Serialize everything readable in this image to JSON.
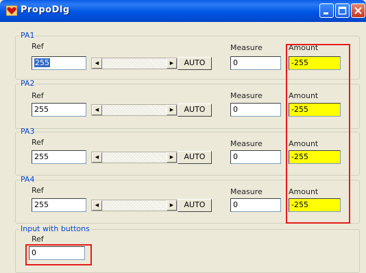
{
  "window": {
    "title": "PropoDlg"
  },
  "groups": [
    {
      "name": "PA1",
      "ref_label": "Ref",
      "ref_value": "255",
      "measure_label": "Measure",
      "measure_value": "0",
      "amount_label": "Amount",
      "amount_value": "-255",
      "auto_label": "AUTO"
    },
    {
      "name": "PA2",
      "ref_label": "Ref",
      "ref_value": "255",
      "measure_label": "Measure",
      "measure_value": "0",
      "amount_label": "Amount",
      "amount_value": "-255",
      "auto_label": "AUTO"
    },
    {
      "name": "PA3",
      "ref_label": "Ref",
      "ref_value": "255",
      "measure_label": "Measure",
      "measure_value": "0",
      "amount_label": "Amount",
      "amount_value": "-255",
      "auto_label": "AUTO"
    },
    {
      "name": "PA4",
      "ref_label": "Ref",
      "ref_value": "255",
      "measure_label": "Measure",
      "measure_value": "0",
      "amount_label": "Amount",
      "amount_value": "-255",
      "auto_label": "AUTO"
    }
  ],
  "input_group": {
    "name": "Input with buttons",
    "ref_label": "Ref",
    "ref_value": "0"
  },
  "icons": {
    "app": "heart-icon",
    "minimize": "minimize-icon",
    "maximize": "maximize-icon",
    "close": "close-icon"
  },
  "colors": {
    "amount_background": "#FFFF00",
    "highlight_box": "#E41A1A",
    "titlebar": "#0055E5"
  }
}
